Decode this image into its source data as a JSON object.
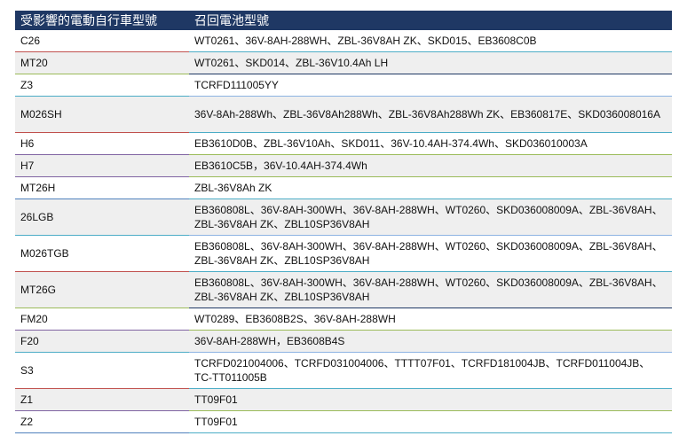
{
  "header": {
    "model_col": "受影響的電動自行車型號",
    "battery_col": "召回電池型號"
  },
  "rows": [
    {
      "model": "C26",
      "batteries": "WT0261、36V-8AH-288WH、ZBL-36V8AH ZK、SKD015、EB3608C0B"
    },
    {
      "model": "MT20",
      "batteries": "WT0261、SKD014、ZBL-36V10.4Ah LH"
    },
    {
      "model": "Z3",
      "batteries": "TCRFD111005YY"
    },
    {
      "model": "M026SH",
      "batteries": "36V-8Ah-288Wh、ZBL-36V8Ah288Wh、ZBL-36V8Ah288Wh ZK、EB360817E、SKD036008016A"
    },
    {
      "model": "H6",
      "batteries": "EB3610D0B、ZBL-36V10Ah、SKD011、36V-10.4AH-374.4Wh、SKD036010003A"
    },
    {
      "model": "H7",
      "batteries": "EB3610C5B，36V-10.4AH-374.4Wh"
    },
    {
      "model": "MT26H",
      "batteries": "ZBL-36V8Ah ZK"
    },
    {
      "model": "26LGB",
      "batteries": "EB360808L、36V-8AH-300WH、36V-8AH-288WH、WT0260、SKD036008009A、ZBL-36V8AH、ZBL-36V8AH ZK、ZBL10SP36V8AH"
    },
    {
      "model": "M026TGB",
      "batteries": "EB360808L、36V-8AH-300WH、36V-8AH-288WH、WT0260、SKD036008009A、ZBL-36V8AH、ZBL-36V8AH ZK、ZBL10SP36V8AH"
    },
    {
      "model": "MT26G",
      "batteries": "EB360808L、36V-8AH-300WH、36V-8AH-288WH、WT0260、SKD036008009A、ZBL-36V8AH、ZBL-36V8AH ZK、ZBL10SP36V8AH"
    },
    {
      "model": "FM20",
      "batteries": "WT0289、EB3608B2S、36V-8AH-288WH"
    },
    {
      "model": "F20",
      "batteries": "36V-8AH-288WH，EB3608B4S"
    },
    {
      "model": "S3",
      "batteries": "TCRFD021004006、TCRFD031004006、TTTT07F01、TCRFD181004JB、TCRFD011004JB、TC-TT011005B"
    },
    {
      "model": "Z1",
      "batteries": "TT09F01"
    },
    {
      "model": "Z2",
      "batteries": "TT09F01"
    }
  ]
}
